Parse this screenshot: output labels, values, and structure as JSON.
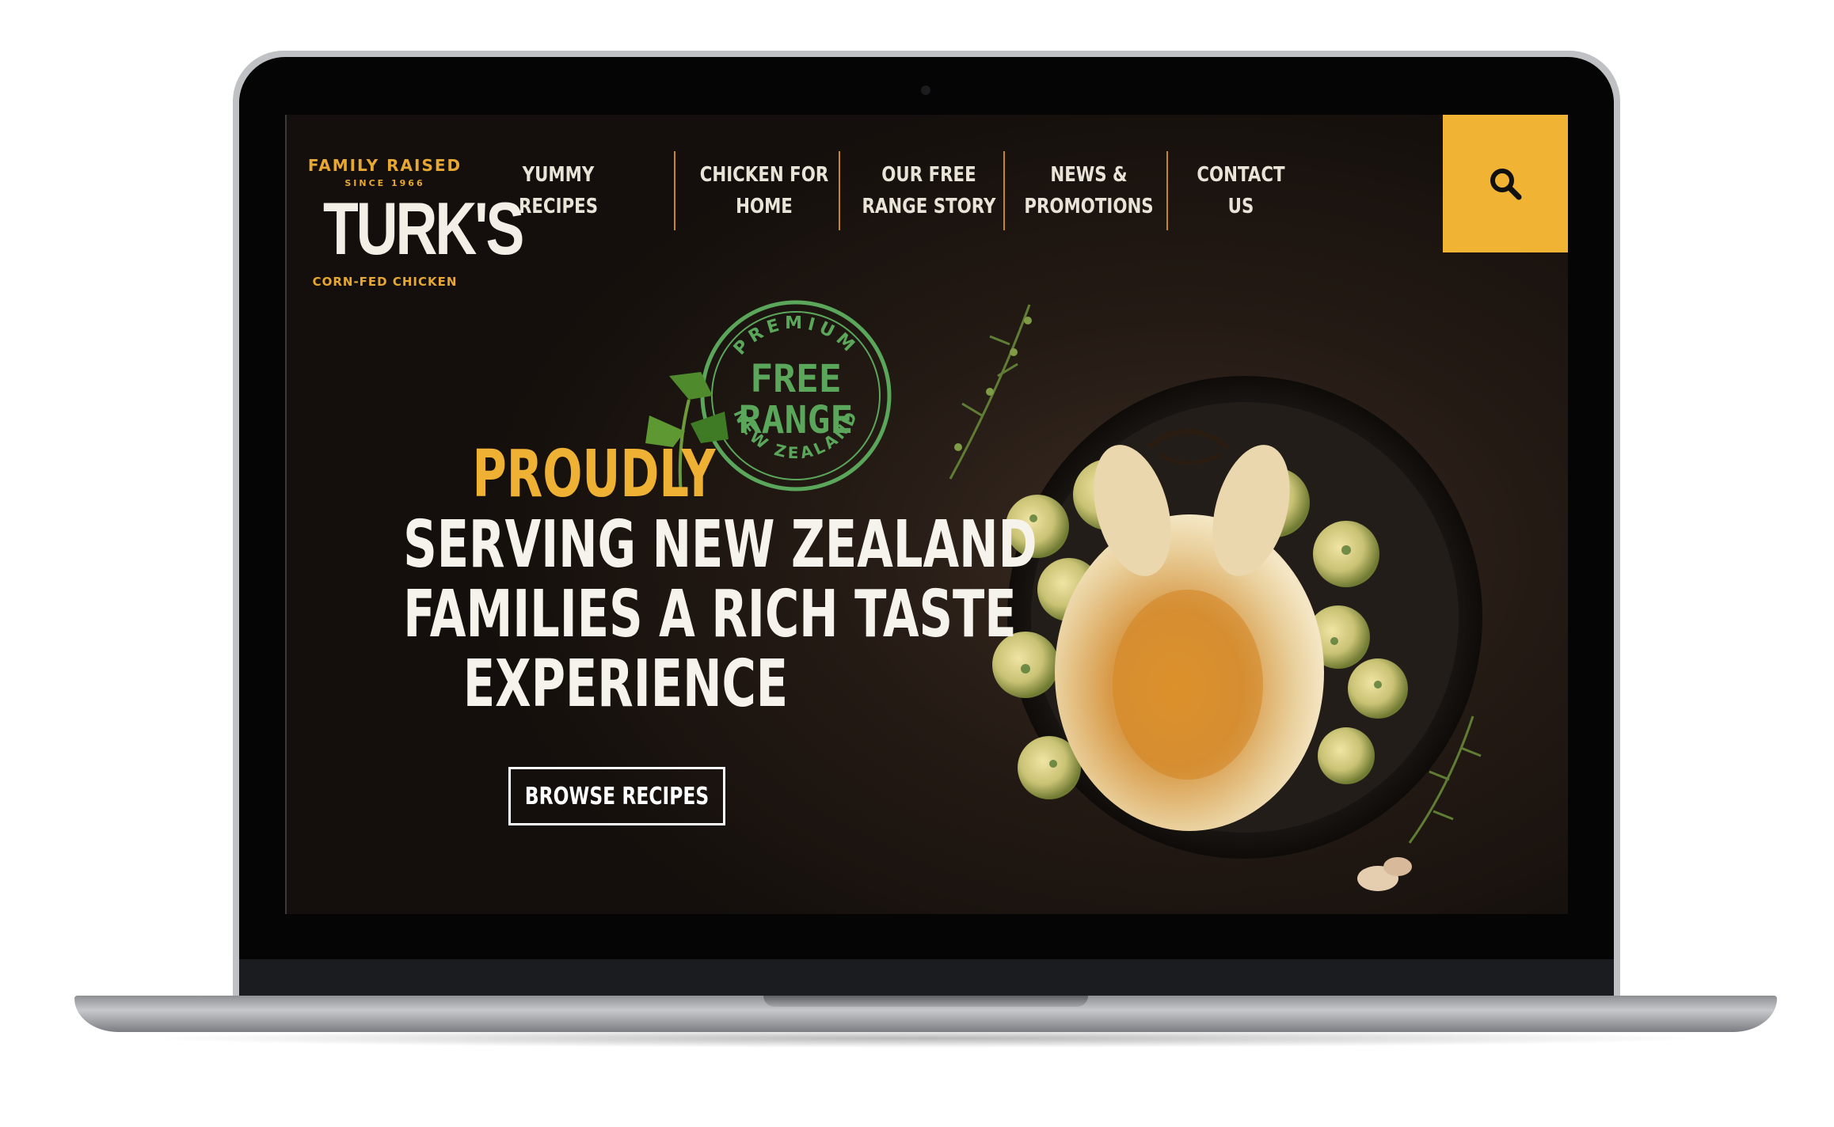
{
  "brand": {
    "tagline_top": "FAMILY RAISED",
    "since": "SINCE 1966",
    "name": "TURK'S",
    "tagline_bottom": "CORN-FED CHICKEN"
  },
  "nav": {
    "items": [
      {
        "label": "YUMMY\nRECIPES"
      },
      {
        "label": "CHICKEN FOR\nHOME"
      },
      {
        "label": "OUR FREE\nRANGE STORY"
      },
      {
        "label": "NEWS &\nPROMOTIONS"
      },
      {
        "label": "CONTACT US"
      }
    ],
    "search_icon": "search-icon"
  },
  "stamp": {
    "top": "PREMIUM",
    "line1": "FREE",
    "line2": "RANGE",
    "bottom": "NEW ZEALAND"
  },
  "hero": {
    "highlight": "PROUDLY",
    "lines": [
      "SERVING NEW ZEALAND",
      "FAMILIES A RICH TASTE",
      "EXPERIENCE"
    ],
    "cta_label": "BROWSE RECIPES"
  },
  "colors": {
    "accent": "#f0b334",
    "stamp_green": "#5aa65a",
    "text": "#f6f3ec"
  }
}
